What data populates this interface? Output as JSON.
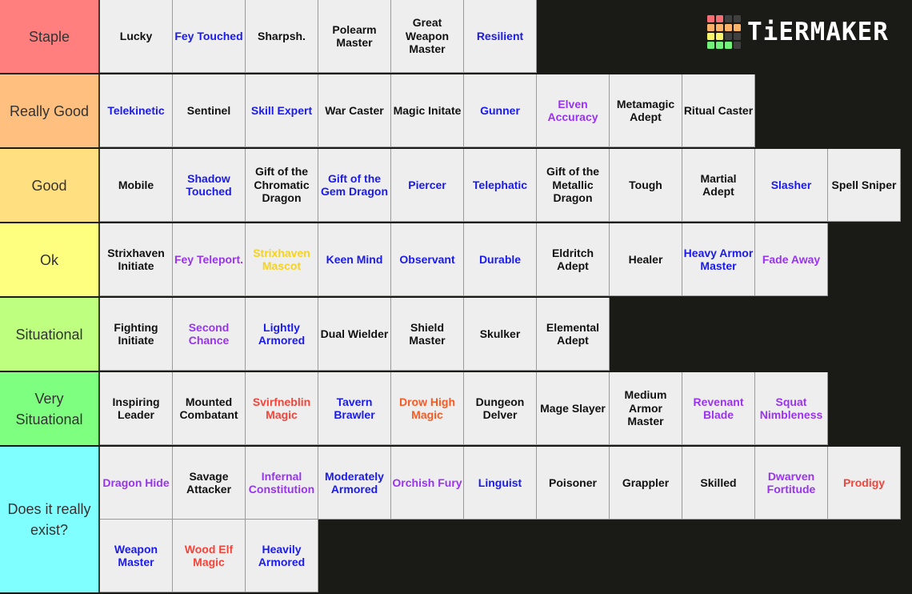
{
  "logo": {
    "text": "TiERMAKER",
    "grid_colors": [
      "#f76d74",
      "#f76d74",
      "#404040",
      "#404040",
      "#fdb26a",
      "#fdb26a",
      "#fdb26a",
      "#fdb26a",
      "#f8f56b",
      "#f8f56b",
      "#404040",
      "#404040",
      "#72f27a",
      "#72f27a",
      "#72f27a",
      "#404040"
    ]
  },
  "colors": {
    "black": "#111111",
    "blue": "#1a1aee",
    "purple": "#9a33f0",
    "red": "#f4443a",
    "orange": "#f75a23",
    "yellow": "#f7d21c",
    "background": "#1a1a17",
    "item_bg": "#eeeeee"
  },
  "tiers": [
    {
      "label": "Staple",
      "color": "#ff7f7f",
      "items": [
        {
          "text": "Lucky",
          "color": "black"
        },
        {
          "text": "Fey Touched",
          "color": "blue"
        },
        {
          "text": "Sharpsh.",
          "color": "black"
        },
        {
          "text": "Polearm Master",
          "color": "black"
        },
        {
          "text": "Great Weapon Master",
          "color": "black"
        },
        {
          "text": "Resilient",
          "color": "blue"
        }
      ]
    },
    {
      "label": "Really Good",
      "color": "#ffbf7f",
      "items": [
        {
          "text": "Telekinetic",
          "color": "blue"
        },
        {
          "text": "Sentinel",
          "color": "black"
        },
        {
          "text": "Skill Expert",
          "color": "blue"
        },
        {
          "text": "War Caster",
          "color": "black"
        },
        {
          "text": "Magic Initate",
          "color": "black"
        },
        {
          "text": "Gunner",
          "color": "blue"
        },
        {
          "text": "Elven Accuracy",
          "color": "purple"
        },
        {
          "text": "Metamagic Adept",
          "color": "black"
        },
        {
          "text": "Ritual Caster",
          "color": "black"
        }
      ]
    },
    {
      "label": "Good",
      "color": "#ffdf7f",
      "items": [
        {
          "text": "Mobile",
          "color": "black"
        },
        {
          "text": "Shadow Touched",
          "color": "blue"
        },
        {
          "text": "Gift of the Chromatic Dragon",
          "color": "black"
        },
        {
          "text": "Gift of the Gem Dragon",
          "color": "blue"
        },
        {
          "text": "Piercer",
          "color": "blue"
        },
        {
          "text": "Telephatic",
          "color": "blue"
        },
        {
          "text": "Gift of the Metallic Dragon",
          "color": "black"
        },
        {
          "text": "Tough",
          "color": "black"
        },
        {
          "text": "Martial Adept",
          "color": "black"
        },
        {
          "text": "Slasher",
          "color": "blue"
        },
        {
          "text": "Spell Sniper",
          "color": "black"
        }
      ]
    },
    {
      "label": "Ok",
      "color": "#ffff7f",
      "items": [
        {
          "text": "Strixhaven Initiate",
          "color": "black"
        },
        {
          "text": "Fey Teleport.",
          "color": "purple"
        },
        {
          "text": "Strixhaven Mascot",
          "color": "yellow"
        },
        {
          "text": "Keen Mind",
          "color": "blue"
        },
        {
          "text": "Observant",
          "color": "blue"
        },
        {
          "text": "Durable",
          "color": "blue"
        },
        {
          "text": "Eldritch Adept",
          "color": "black"
        },
        {
          "text": "Healer",
          "color": "black"
        },
        {
          "text": "Heavy Armor Master",
          "color": "blue"
        },
        {
          "text": "Fade Away",
          "color": "purple"
        }
      ]
    },
    {
      "label": "Situational",
      "color": "#bfff7f",
      "items": [
        {
          "text": "Fighting Initiate",
          "color": "black"
        },
        {
          "text": "Second Chance",
          "color": "purple"
        },
        {
          "text": "Lightly Armored",
          "color": "blue"
        },
        {
          "text": "Dual Wielder",
          "color": "black"
        },
        {
          "text": "Shield Master",
          "color": "black"
        },
        {
          "text": "Skulker",
          "color": "black"
        },
        {
          "text": "Elemental Adept",
          "color": "black"
        }
      ]
    },
    {
      "label": "Very Situational",
      "color": "#7fff7f",
      "items": [
        {
          "text": "Inspiring Leader",
          "color": "black"
        },
        {
          "text": "Mounted Combatant",
          "color": "black"
        },
        {
          "text": "Svirfneblin Magic",
          "color": "red"
        },
        {
          "text": "Tavern Brawler",
          "color": "blue"
        },
        {
          "text": "Drow High Magic",
          "color": "orange"
        },
        {
          "text": "Dungeon Delver",
          "color": "black"
        },
        {
          "text": "Mage Slayer",
          "color": "black"
        },
        {
          "text": "Medium Armor Master",
          "color": "black"
        },
        {
          "text": "Revenant Blade",
          "color": "purple"
        },
        {
          "text": "Squat Nimbleness",
          "color": "purple"
        }
      ]
    },
    {
      "label": "Does it really exist?",
      "color": "#7fffff",
      "items": [
        {
          "text": "Dragon Hide",
          "color": "purple"
        },
        {
          "text": "Savage Attacker",
          "color": "black"
        },
        {
          "text": "Infernal Constitution",
          "color": "purple"
        },
        {
          "text": "Moderately Armored",
          "color": "blue"
        },
        {
          "text": "Orchish Fury",
          "color": "purple"
        },
        {
          "text": "Linguist",
          "color": "blue"
        },
        {
          "text": "Poisoner",
          "color": "black"
        },
        {
          "text": "Grappler",
          "color": "black"
        },
        {
          "text": "Skilled",
          "color": "black"
        },
        {
          "text": "Dwarven Fortitude",
          "color": "purple"
        },
        {
          "text": "Prodigy",
          "color": "red"
        },
        {
          "text": "Weapon Master",
          "color": "blue"
        },
        {
          "text": "Wood Elf Magic",
          "color": "red"
        },
        {
          "text": "Heavily Armored",
          "color": "blue"
        }
      ]
    }
  ]
}
